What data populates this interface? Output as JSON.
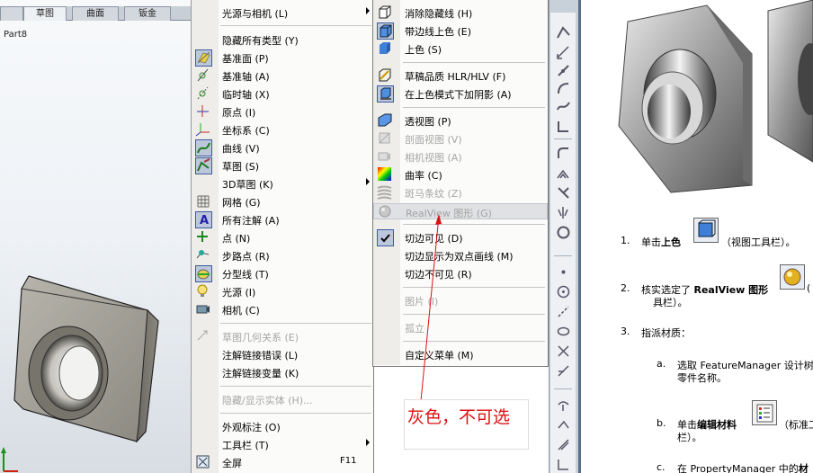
{
  "viewport": {
    "tabs": [
      "",
      "草图",
      "曲面",
      "钣金"
    ],
    "part_name": "Part8"
  },
  "main_menu": {
    "items": [
      {
        "label": "光源与相机 (L)",
        "submenu": true
      },
      {
        "label": "隐藏所有类型 (Y)"
      },
      {
        "label": "基准面 (P)",
        "icon": "plane-icon"
      },
      {
        "label": "基准轴 (A)",
        "icon": "axis-icon"
      },
      {
        "label": "临时轴 (X)",
        "icon": "temp-axis-icon"
      },
      {
        "label": "原点 (I)",
        "icon": "origin-icon"
      },
      {
        "label": "坐标系 (C)",
        "icon": "coordinate-system-icon"
      },
      {
        "label": "曲线 (V)",
        "icon": "curve-icon"
      },
      {
        "label": "草图 (S)",
        "icon": "sketch-icon"
      },
      {
        "label": "3D草图 (K)",
        "submenu": true
      },
      {
        "label": "网格 (G)",
        "icon": "grid-icon"
      },
      {
        "label": "所有注解 (A)",
        "icon": "annotation-icon"
      },
      {
        "label": "点 (N)",
        "icon": "point-icon"
      },
      {
        "label": "步路点 (R)",
        "icon": "route-point-icon"
      },
      {
        "label": "分型线 (T)",
        "icon": "parting-line-icon"
      },
      {
        "label": "光源 (I)",
        "icon": "light-icon"
      },
      {
        "label": "相机 (C)",
        "icon": "camera-icon"
      },
      {
        "label": "草图几何关系 (E)",
        "disabled": true
      },
      {
        "label": "注解链接错误 (L)"
      },
      {
        "label": "注解链接变量 (K)"
      },
      {
        "label": "隐藏/显示实体 (H)...",
        "disabled": true
      },
      {
        "label": "外观标注 (O)"
      },
      {
        "label": "工具栏 (T)",
        "submenu": true
      },
      {
        "label": "全屏",
        "shortcut": "F11"
      }
    ]
  },
  "sub_menu": {
    "items": [
      {
        "label": "消除隐藏线 (H)"
      },
      {
        "label": "带边线上色 (E)"
      },
      {
        "label": "上色 (S)"
      },
      {
        "label": "草稿品质 HLR/HLV (F)"
      },
      {
        "label": "在上色模式下加阴影 (A)"
      },
      {
        "label": "透视图 (P)"
      },
      {
        "label": "剖面视图 (V)"
      },
      {
        "label": "相机视图 (A)"
      },
      {
        "label": "曲率 (C)"
      },
      {
        "label": "斑马条纹 (Z)"
      },
      {
        "label": "RealView 图形 (G)"
      },
      {
        "label": "切边可见 (D)"
      },
      {
        "label": "切边显示为双点画线 (M)"
      },
      {
        "label": "切边不可见 (R)"
      },
      {
        "label": "图片 (I)"
      },
      {
        "label": "孤立"
      },
      {
        "label": "自定义菜单 (M)"
      }
    ]
  },
  "annotation": {
    "text": "灰色，不可选"
  },
  "help": {
    "step1": {
      "num": "1.",
      "pre": "单击",
      "bold": "上色",
      "post": "（视图工具栏）。"
    },
    "step2": {
      "num": "2.",
      "pre": "核实选定了 ",
      "bold": "RealView 图形",
      "cont": "具栏）。"
    },
    "step3": {
      "num": "3.",
      "text": "指派材质："
    },
    "step3a": {
      "num": "a.",
      "line1": "选取 FeatureManager 设计树",
      "line2": "零件名称。"
    },
    "step3b": {
      "num": "b.",
      "pre": "单击",
      "bold": "编辑材料",
      "post": "（标准工",
      "line2": "栏）。"
    },
    "step3c": {
      "num": "c.",
      "pre": "在 PropertyManager 中的",
      "bold": "材"
    }
  },
  "colors": {
    "annotation_red": "#dd1111",
    "menu_highlight": "#dfe1e4",
    "panel_divider": "#5a6f86"
  }
}
